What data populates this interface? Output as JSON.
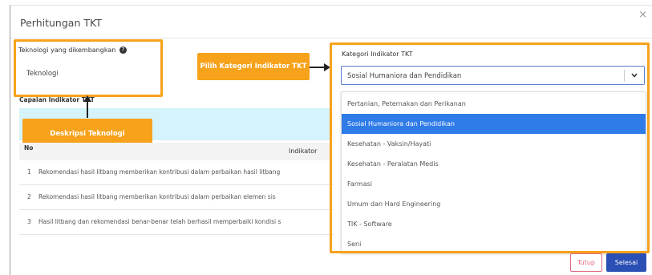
{
  "modal": {
    "title": "Perhitungan TKT",
    "close_symbol": "×"
  },
  "technology": {
    "label": "Teknologi yang dikembangkan",
    "help_symbol": "?",
    "value": "Teknologi"
  },
  "capaian": {
    "label": "Capaian Indikator TKT"
  },
  "table": {
    "header_no": "No",
    "header_indicator": "Indikator",
    "rows": [
      {
        "no": "1",
        "text": "Rekomendasi hasil litbang memberikan kontribusi dalam perbaikan hasil litbang"
      },
      {
        "no": "2",
        "text": "Rekomendasi hasil litbang memberikan kontribusi dalam perbaikan elemen sis"
      },
      {
        "no": "3",
        "text": "Hasil litbang dan rekomendasi benar-benar telah berhasil memperbaiki kondisi s"
      }
    ]
  },
  "callouts": {
    "deskripsi": "Deskripsi Teknologi",
    "pilih": "Pilih Kategori Indikator TKT"
  },
  "category": {
    "label": "Kategori Indikator TKT",
    "selected_value": "Sosial Humaniora dan Pendidikan",
    "chevron_symbol": "⌄",
    "options": [
      "Pertanian, Peternakan dan Perikanan",
      "Sosial Humaniora dan Pendidikan",
      "Kesehatan - Vaksin/Hayati",
      "Kesehatan - Peralatan Medis",
      "Farmasi",
      "Umum dan Hard Engineering",
      "TIK - Software",
      "Seni"
    ],
    "selected_index": 1
  },
  "buttons": {
    "tutup": "Tutup",
    "selesai": "Selesai"
  },
  "colors": {
    "highlight": "#f7a21b",
    "selected_option": "#2f7be8",
    "primary_button": "#2a4fb5",
    "close_button": "#e06b83"
  }
}
